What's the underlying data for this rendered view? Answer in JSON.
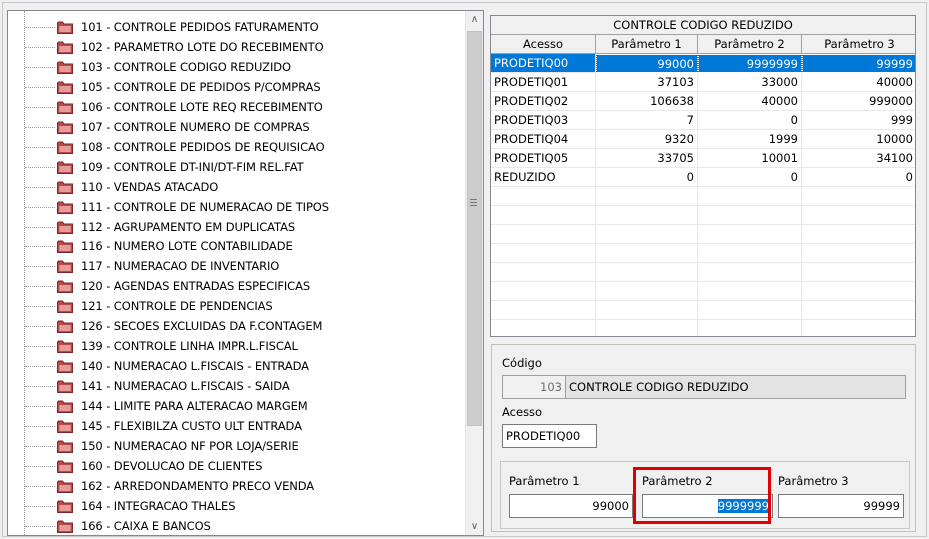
{
  "tree": {
    "items": [
      "101 - CONTROLE PEDIDOS FATURAMENTO",
      "102 - PARAMETRO LOTE DO RECEBIMENTO",
      "103 - CONTROLE CODIGO REDUZIDO",
      "105 - CONTROLE DE PEDIDOS P/COMPRAS",
      "106 - CONTROLE LOTE REQ RECEBIMENTO",
      "107 - CONTROLE NUMERO DE COMPRAS",
      "108 - CONTROLE PEDIDOS DE REQUISICAO",
      "109 - CONTROLE DT-INI/DT-FIM REL.FAT",
      "110 - VENDAS ATACADO",
      "111 - CONTROLE DE NUMERACAO DE TIPOS",
      "112 - AGRUPAMENTO EM DUPLICATAS",
      "116 - NUMERO LOTE CONTABILIDADE",
      "117 - NUMERACAO DE INVENTARIO",
      "120 - AGENDAS ENTRADAS ESPECIFICAS",
      "121 - CONTROLE DE PENDENCIAS",
      "126 - SECOES EXCLUIDAS DA F.CONTAGEM",
      "139 - CONTROLE LINHA IMPR.L.FISCAL",
      "140 - NUMERACAO L.FISCAIS - ENTRADA",
      "141 - NUMERACAO L.FISCAIS - SAIDA",
      "144 - LIMITE PARA ALTERACAO MARGEM",
      "145 - FLEXIBILZA CUSTO ULT ENTRADA",
      "150 - NUMERACAO NF POR LOJA/SERIE",
      "160 - DEVOLUCAO DE CLIENTES",
      "162 - ARREDONDAMENTO PRECO VENDA",
      "164 - INTEGRACAO THALES",
      "166 - CAIXA E BANCOS"
    ],
    "scroll_up": "∧",
    "scroll_down": "∨"
  },
  "grid": {
    "title": "CONTROLE CODIGO REDUZIDO",
    "columns": [
      "Acesso",
      "Parâmetro 1",
      "Parâmetro 2",
      "Parâmetro 3"
    ],
    "rows": [
      [
        "PRODETIQ00",
        "99000",
        "9999999",
        "99999"
      ],
      [
        "PRODETIQ01",
        "37103",
        "33000",
        "40000"
      ],
      [
        "PRODETIQ02",
        "106638",
        "40000",
        "999000"
      ],
      [
        "PRODETIQ03",
        "7",
        "0",
        "999"
      ],
      [
        "PRODETIQ04",
        "9320",
        "1999",
        "10000"
      ],
      [
        "PRODETIQ05",
        "33705",
        "10001",
        "34100"
      ],
      [
        "REDUZIDO",
        "0",
        "0",
        "0"
      ]
    ],
    "selected_row": 0
  },
  "detail": {
    "codigo_label": "Código",
    "codigo_value": "103",
    "codigo_desc": "CONTROLE CODIGO REDUZIDO",
    "acesso_label": "Acesso",
    "acesso_value": "PRODETIQ00",
    "param1_label": "Parâmetro 1",
    "param1_value": "99000",
    "param2_label": "Parâmetro 2",
    "param2_value": "9999999",
    "param3_label": "Parâmetro 3",
    "param3_value": "99999"
  },
  "colors": {
    "selection": "#0078d7",
    "highlight_box": "#e00000",
    "folder": "#c0504d"
  }
}
